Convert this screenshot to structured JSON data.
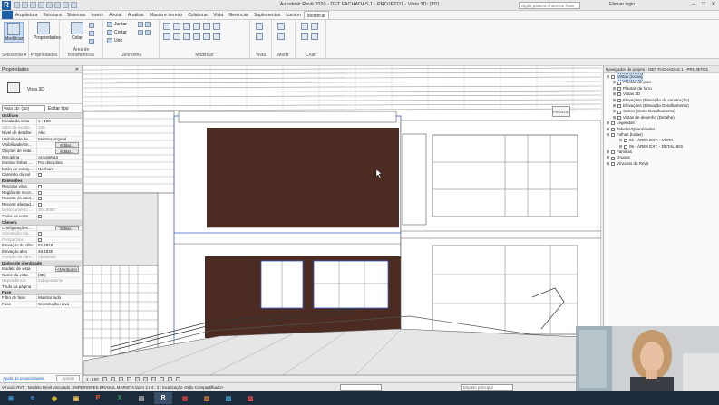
{
  "app": {
    "title": "Autodesk Revit 2020 -    DET FACHADAS 1 - PROJETO1 - Vista 3D: {3D}",
    "search_placeholder": "Digite palavra-chave ou frase",
    "user": "Efetuar login"
  },
  "menu": {
    "tabs": [
      "Arquitetura",
      "Estrutura",
      "Sistemas",
      "Inserir",
      "Anotar",
      "Analisar",
      "Massa e terreno",
      "Colaborar",
      "Vista",
      "Gerenciar",
      "Suplementos",
      "Lumion",
      "Modificar"
    ]
  },
  "ribbon": {
    "groups": [
      {
        "label": "Selecionar ▾"
      },
      {
        "label": "Propriedades"
      },
      {
        "label": "Área de transferência"
      },
      {
        "label": "Geometria"
      },
      {
        "label": "Modificar"
      },
      {
        "label": "Vista"
      },
      {
        "label": "Medir"
      },
      {
        "label": "Criar"
      }
    ],
    "buttons": {
      "modify": "Modificar",
      "properties": "Propriedades",
      "paste": "Colar"
    },
    "geometry_items": [
      "Juntar",
      "Cortar",
      "Unir"
    ]
  },
  "properties": {
    "header": "Propriedades",
    "type_name": "Vista 3D",
    "selector_value": "Vista 3D: {3D}",
    "edit_type": "Editar tipo",
    "sections": [
      {
        "name": "Gráficos",
        "rows": [
          {
            "k": "Escala da vista",
            "v": "1 : 100"
          },
          {
            "k": "Valor da escala",
            "v": "100",
            "dis": true
          },
          {
            "k": "Nível de detalhe",
            "v": "Alto"
          },
          {
            "k": "Visibilidade de ...",
            "v": "Mostrar original"
          },
          {
            "k": "Visibilidade/Sn...",
            "v": "",
            "btn": "Editar..."
          },
          {
            "k": "Opções de exibi...",
            "v": "",
            "btn": "Editar..."
          },
          {
            "k": "Disciplina",
            "v": "Arquitetura"
          },
          {
            "k": "Mostrar linhas ...",
            "v": "Por disciplina"
          },
          {
            "k": "Estilo de exibiç...",
            "v": "Nenhum"
          },
          {
            "k": "Caminho do sol",
            "v": "",
            "chk": true
          }
        ]
      },
      {
        "name": "Extensões",
        "rows": [
          {
            "k": "Recortar vista",
            "v": "",
            "chk": true
          },
          {
            "k": "Região de recor...",
            "v": "",
            "chk": true
          },
          {
            "k": "Recorte de anot...",
            "v": "",
            "chk": true
          },
          {
            "k": "Recorte afastad...",
            "v": "",
            "chk": true
          },
          {
            "k": "Deslocamento ...",
            "v": "304.8000",
            "dis": true
          },
          {
            "k": "Caixa de corte",
            "v": "",
            "chk": true
          }
        ]
      },
      {
        "name": "Câmera",
        "rows": [
          {
            "k": "Configurações ...",
            "v": "",
            "btn": "Editar..."
          },
          {
            "k": "Orientação blo...",
            "v": "",
            "chk": true,
            "dis": true
          },
          {
            "k": "Perspectiva",
            "v": "",
            "chk": true,
            "dis": true
          },
          {
            "k": "Elevação do olho",
            "v": "62.4818"
          },
          {
            "k": "Elevação alvo",
            "v": "48.1830"
          },
          {
            "k": "Posição da câm...",
            "v": "Ajustando",
            "dis": true
          }
        ]
      },
      {
        "name": "Dados de identidade",
        "rows": [
          {
            "k": "Modelo de vista",
            "v": "",
            "btn": "<Nenhum>"
          },
          {
            "k": "Nome da vista",
            "v": "{3D}"
          },
          {
            "k": "Dependência",
            "v": "Independente",
            "dis": true
          },
          {
            "k": "Título da página",
            "v": ""
          }
        ]
      },
      {
        "name": "Fase",
        "rows": [
          {
            "k": "Filtro de fase",
            "v": "Mostrar tudo"
          },
          {
            "k": "Fase",
            "v": "Construção nova"
          }
        ]
      }
    ],
    "help_link": "Ajuda de propriedades",
    "apply": "Aplicar"
  },
  "browser": {
    "header": "Navegador de projeto - DET FACHADAS 1 - PROJETO1",
    "nodes": [
      {
        "label": "Vistas (todas)",
        "level": 1,
        "toggle": "⊟",
        "sel": true
      },
      {
        "label": "Plantas de piso",
        "level": 2,
        "toggle": "⊞"
      },
      {
        "label": "Plantas de forro",
        "level": 2,
        "toggle": "⊞"
      },
      {
        "label": "Vistas 3D",
        "level": 2,
        "toggle": "⊞"
      },
      {
        "label": "Elevações (Elevação da construção)",
        "level": 2,
        "toggle": "⊞"
      },
      {
        "label": "Elevações (Elevação Detalhamento)",
        "level": 2,
        "toggle": "⊞"
      },
      {
        "label": "Cortes (Corte Detalhamento)",
        "level": 2,
        "toggle": "⊞"
      },
      {
        "label": "Vistas de desenho (Detalhe)",
        "level": 2,
        "toggle": "⊞"
      },
      {
        "label": "Legendas",
        "level": 1,
        "toggle": "⊞"
      },
      {
        "label": "Tabelas/Quantidades",
        "level": 1,
        "toggle": "⊞"
      },
      {
        "label": "Folhas (todas)",
        "level": 1,
        "toggle": "⊟"
      },
      {
        "label": "05 - ÁREA EXT. - VISTA",
        "level": 3,
        "toggle": "⊞"
      },
      {
        "label": "06 - ÁREA EXT. - DETALHES",
        "level": 3,
        "toggle": "⊞"
      },
      {
        "label": "Famílias",
        "level": 1,
        "toggle": "⊞"
      },
      {
        "label": "Grupos",
        "level": 1,
        "toggle": "⊞"
      },
      {
        "label": "Vínculos do Revit",
        "level": 1,
        "toggle": "⊞"
      }
    ]
  },
  "viewcube_label": "FRONTAL",
  "view_control": {
    "scale": "1 : 100"
  },
  "status": {
    "text": "Vínculo RVT : Modelo Revit vinculado : INFERIORES BRASAL MARISTA lazer 2.rvt : 2 : localização <Não Compartilhado>",
    "model": "Modelo principal"
  },
  "taskbar": {
    "items": [
      "⊞",
      "e",
      "◉",
      "▣",
      "P",
      "X",
      "▤",
      "R",
      "▦",
      "▥",
      "▧",
      "▨"
    ]
  },
  "colors": {
    "accent": "#1b5fa6",
    "wall_brown": "#4b2b22",
    "selection_blue": "#3a5fd0"
  }
}
